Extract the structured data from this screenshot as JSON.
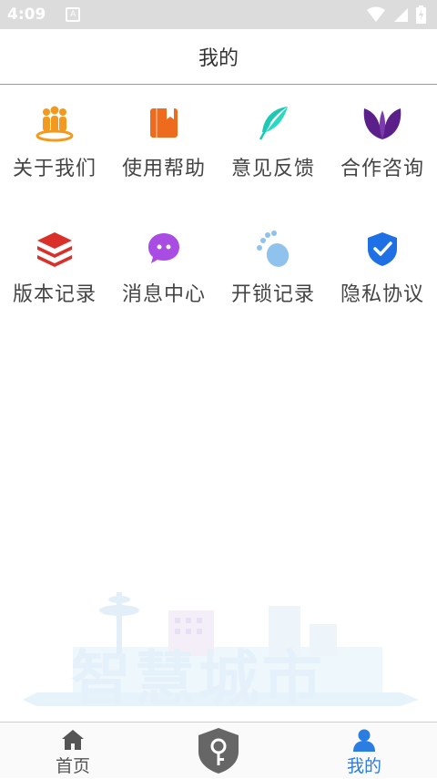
{
  "status_bar": {
    "time": "4:09",
    "notification_icon": "A"
  },
  "header": {
    "title": "我的"
  },
  "menu": {
    "items": [
      {
        "label": "关于我们",
        "icon": "people-icon",
        "color": "#f19a1f"
      },
      {
        "label": "使用帮助",
        "icon": "book-icon",
        "color": "#ee6a1c"
      },
      {
        "label": "意见反馈",
        "icon": "feather-icon",
        "color": "#1dc8b4"
      },
      {
        "label": "合作咨询",
        "icon": "leaf-icon",
        "color": "#5b1f8a"
      },
      {
        "label": "版本记录",
        "icon": "layers-icon",
        "color": "#d9302a"
      },
      {
        "label": "消息中心",
        "icon": "chat-icon",
        "color": "#a94ce3"
      },
      {
        "label": "开锁记录",
        "icon": "footprint-icon",
        "color": "#8fc3ee"
      },
      {
        "label": "隐私协议",
        "icon": "shield-check-icon",
        "color": "#1f6fe5"
      }
    ]
  },
  "banner": {
    "text": "智慧城市"
  },
  "tabbar": {
    "home_label": "首页",
    "mine_label": "我的",
    "active_color": "#2a7de1"
  }
}
